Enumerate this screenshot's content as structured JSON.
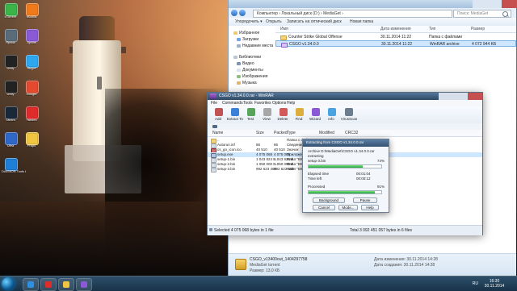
{
  "desktop": {
    "icons": [
      {
        "label": "uTorrent",
        "color": "#3bb54a"
      },
      {
        "label": "Mozilla",
        "color": "#f07a1a"
      },
      {
        "label": "Ярлык",
        "color": "#5a6b7a"
      },
      {
        "label": "Архив",
        "color": "#8a5ad6"
      },
      {
        "label": "Unity",
        "color": "#222222"
      },
      {
        "label": "Skype",
        "color": "#2da8f0"
      },
      {
        "label": "Unity",
        "color": "#222222"
      },
      {
        "label": "Google",
        "color": "#e64a2e"
      },
      {
        "label": "Steam",
        "color": "#1b2838"
      },
      {
        "label": "Yandex",
        "color": "#e02b2b"
      },
      {
        "label": "Ultra",
        "color": "#3068c8"
      },
      {
        "label": "Fraps",
        "color": "#f0c640"
      },
      {
        "label": "DAEMON Tools Lite",
        "color": "#1f7fd6"
      }
    ]
  },
  "explorer": {
    "address": "Компьютер › Локальный диск (D:) › MediaGet ›",
    "search_placeholder": "Поиск: MediaGet",
    "toolbar": [
      "Упорядочить ▾",
      "Открыть",
      "Записать на оптический диск",
      "Новая папка"
    ],
    "tree": [
      "Избранное",
      "Загрузки",
      "Недавние места",
      "Библиотеки",
      "Видео",
      "Документы",
      "Изображения",
      "Музыка"
    ],
    "columns": [
      "Имя",
      "Дата изменения",
      "Тип",
      "Размер"
    ],
    "files": [
      {
        "name": "Counter Strike Global Offense",
        "date": "30.11.2014 11:22",
        "type": "Папка с файлами",
        "size": ""
      },
      {
        "name": "CSGO v1.34.0.0",
        "date": "30.11.2014 11:22",
        "type": "WinRAR archive",
        "size": "4 072 944 KБ"
      }
    ],
    "status": {
      "title": "CSGO_v13400out_1404297758",
      "subtitle": "MediaGet torrent",
      "changed_label": "Дата изменения: 30.11.2014 14:28",
      "created_label": "Дата создания: 30.11.2014 14:28",
      "size": "Размер: 13,0 КБ"
    }
  },
  "winrar": {
    "title": "CSGO v1.34.0.0.rar - WinRAR",
    "menu": [
      "File",
      "Commands",
      "Tools",
      "Favorites",
      "Options",
      "Help"
    ],
    "tools": [
      {
        "label": "Add",
        "color": "#c05353"
      },
      {
        "label": "Extract To",
        "color": "#3a7fd8"
      },
      {
        "label": "Test",
        "color": "#58a45a"
      },
      {
        "label": "View",
        "color": "#a7a7a7"
      },
      {
        "label": "Delete",
        "color": "#d35a5a"
      },
      {
        "label": "Find",
        "color": "#dcae3e"
      },
      {
        "label": "Wizard",
        "color": "#8a5ad6"
      },
      {
        "label": "Info",
        "color": "#4aa3e0"
      },
      {
        "label": "VirusScan",
        "color": "#6b7c8d"
      }
    ],
    "columns": [
      "Name",
      "Size",
      "Packed",
      "Type",
      "Modified",
      "CRC32"
    ],
    "rows": [
      {
        "name": "..",
        "size": "",
        "packed": "",
        "type": "Папка с файлами",
        "modified": "",
        "crc": ""
      },
      {
        "name": "Autorun.inf",
        "size": "86",
        "packed": "86",
        "type": "Сведения для...",
        "modified": "",
        "crc": ""
      },
      {
        "name": "cs_go_icon.ico",
        "size": "40 510",
        "packed": "40 510",
        "type": "Значок",
        "modified": "",
        "crc": ""
      },
      {
        "name": "setup.exe",
        "size": "4 075 068",
        "packed": "4 075 068",
        "type": "Приложение",
        "modified": "",
        "crc": ""
      },
      {
        "name": "setup-1.bin",
        "size": "1 043 824 8...",
        "packed": "1 043 824 8...",
        "type": "Файл \"BIN\"",
        "modified": "",
        "crc": ""
      },
      {
        "name": "setup-2.bin",
        "size": "1 050 000 0...",
        "packed": "1 050 000 0...",
        "type": "Файл \"BIN\"",
        "modified": "",
        "crc": ""
      },
      {
        "name": "setup-3.bin",
        "size": "992 623 469",
        "packed": "992 623 469",
        "type": "Файл \"BIN\"",
        "modified": "",
        "crc": ""
      }
    ],
    "status_left": "Selected 4 075 068 bytes in 1 file",
    "status_right": "Total 3 092 451 057 bytes in 6 files"
  },
  "extract_dialog": {
    "title": "Extracting from CSGO v1.34.0.0.rar",
    "archive_line": "Archive D:\\MediaGet\\CSGO v1.34.0.0.rar",
    "action_label": "extracting",
    "file_name": "setup-3.bin",
    "file_percent_text": "74%",
    "file_progress": 0.74,
    "elapsed_label": "Elapsed time",
    "elapsed_value": "00:01:04",
    "left_label": "Time left",
    "left_value": "00:00:12",
    "processed_label": "Processed",
    "processed_percent_text": "91%",
    "processed_progress": 0.91,
    "buttons": [
      "Background",
      "Pause",
      "Cancel",
      "Mode...",
      "Help"
    ]
  },
  "taskbar": {
    "pinned": [
      {
        "name": "ie",
        "color": "#2f8fe2"
      },
      {
        "name": "yandex",
        "color": "#e02b2b"
      },
      {
        "name": "explorer",
        "color": "#f0c640"
      },
      {
        "name": "winrar",
        "color": "#8a5ad6"
      }
    ],
    "lang": "RU",
    "time": "16:30",
    "date": "30.11.2014"
  }
}
